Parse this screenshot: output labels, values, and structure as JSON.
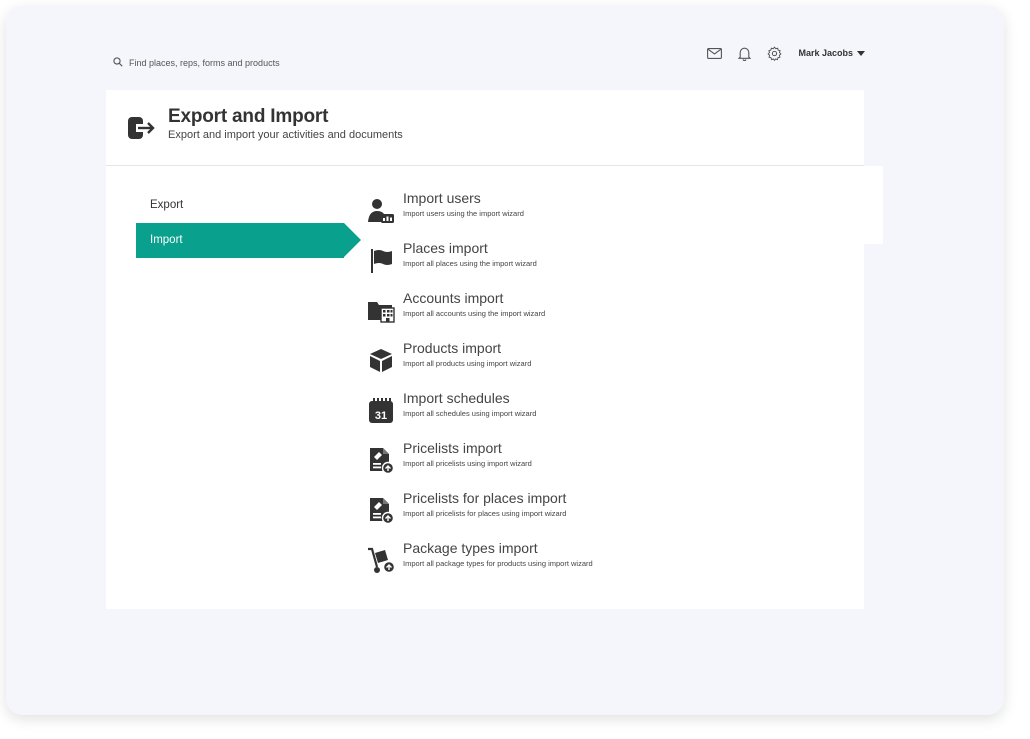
{
  "search": {
    "placeholder": "Find places, reps, forms and products",
    "icon": "search-icon"
  },
  "topbar": {
    "icons": [
      "mail-icon",
      "bell-icon",
      "gear-icon"
    ],
    "user_name": "Mark Jacobs"
  },
  "header": {
    "title": "Export and Import",
    "subtitle": "Export and import your activities and documents",
    "icon": "export-import-icon"
  },
  "nav": {
    "items": [
      {
        "label": "Export",
        "active": false
      },
      {
        "label": "Import",
        "active": true
      }
    ],
    "active_color": "#0aa08e"
  },
  "imports": [
    {
      "title": "Import users",
      "desc": "Import users using the import wizard",
      "icon": "user-import-icon"
    },
    {
      "title": "Places import",
      "desc": "Import all places using the import wizard",
      "icon": "flag-icon"
    },
    {
      "title": "Accounts import",
      "desc": "Import all accounts using the import wizard",
      "icon": "folder-building-icon"
    },
    {
      "title": "Products import",
      "desc": "Import all products using import wizard",
      "icon": "box-icon"
    },
    {
      "title": "Import schedules",
      "desc": "Import all schedules using import wizard",
      "icon": "calendar-icon",
      "icon_text": "31"
    },
    {
      "title": "Pricelists import",
      "desc": "Import all pricelists using import wizard",
      "icon": "pricelist-upload-icon"
    },
    {
      "title": "Pricelists for places import",
      "desc": "Import all pricelists for places using import wizard",
      "icon": "pricelist-upload-icon"
    },
    {
      "title": "Package types import",
      "desc": "Import all package types for products using import wizard",
      "icon": "hand-truck-icon"
    }
  ]
}
